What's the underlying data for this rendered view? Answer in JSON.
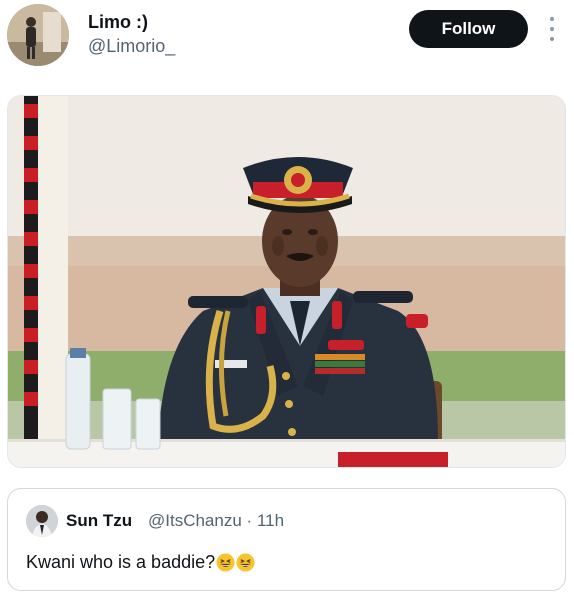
{
  "post": {
    "author_name": "Limo :)",
    "author_handle": "@Limorio_",
    "follow_label": "Follow",
    "more_icon": "more-vertical-icon",
    "media_alt": "Military officer in dress uniform seated at a table"
  },
  "quote": {
    "author_name": "Sun Tzu",
    "author_handle": "@ItsChanzu",
    "separator": "·",
    "time": "11h",
    "text": "Kwani who is a baddie?",
    "emoji": [
      "grinning-squinting-face-emoji",
      "grinning-squinting-face-emoji"
    ]
  },
  "colors": {
    "follow_bg": "#0f1419",
    "text_primary": "#0f1419",
    "text_secondary": "#536471",
    "uniform": "#27313f",
    "cap_band": "#c8202a",
    "gold": "#d9b34a"
  }
}
